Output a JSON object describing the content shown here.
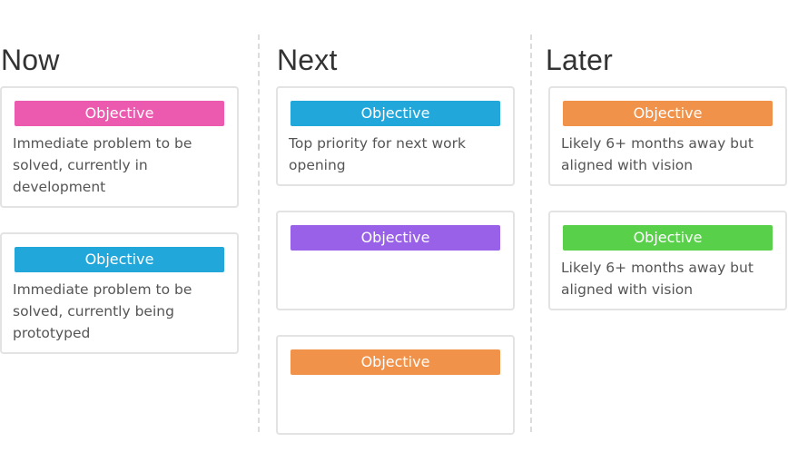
{
  "columns": [
    {
      "title": "Now",
      "cards": [
        {
          "tag": "Objective",
          "color": "#ec5aaf",
          "description": "Immediate problem to be solved, currently in development"
        },
        {
          "tag": "Objective",
          "color": "#22a7db",
          "description": "Immediate problem to be solved, currently being prototyped"
        }
      ]
    },
    {
      "title": "Next",
      "cards": [
        {
          "tag": "Objective",
          "color": "#22a7db",
          "description": "Top priority for next work opening"
        },
        {
          "tag": "Objective",
          "color": "#9961e8",
          "description": ""
        },
        {
          "tag": "Objective",
          "color": "#f1924a",
          "description": ""
        }
      ]
    },
    {
      "title": "Later",
      "cards": [
        {
          "tag": "Objective",
          "color": "#f1924a",
          "description": "Likely 6+ months away but aligned with vision"
        },
        {
          "tag": "Objective",
          "color": "#58d04a",
          "description": "Likely 6+ months away but aligned with vision"
        }
      ]
    }
  ]
}
